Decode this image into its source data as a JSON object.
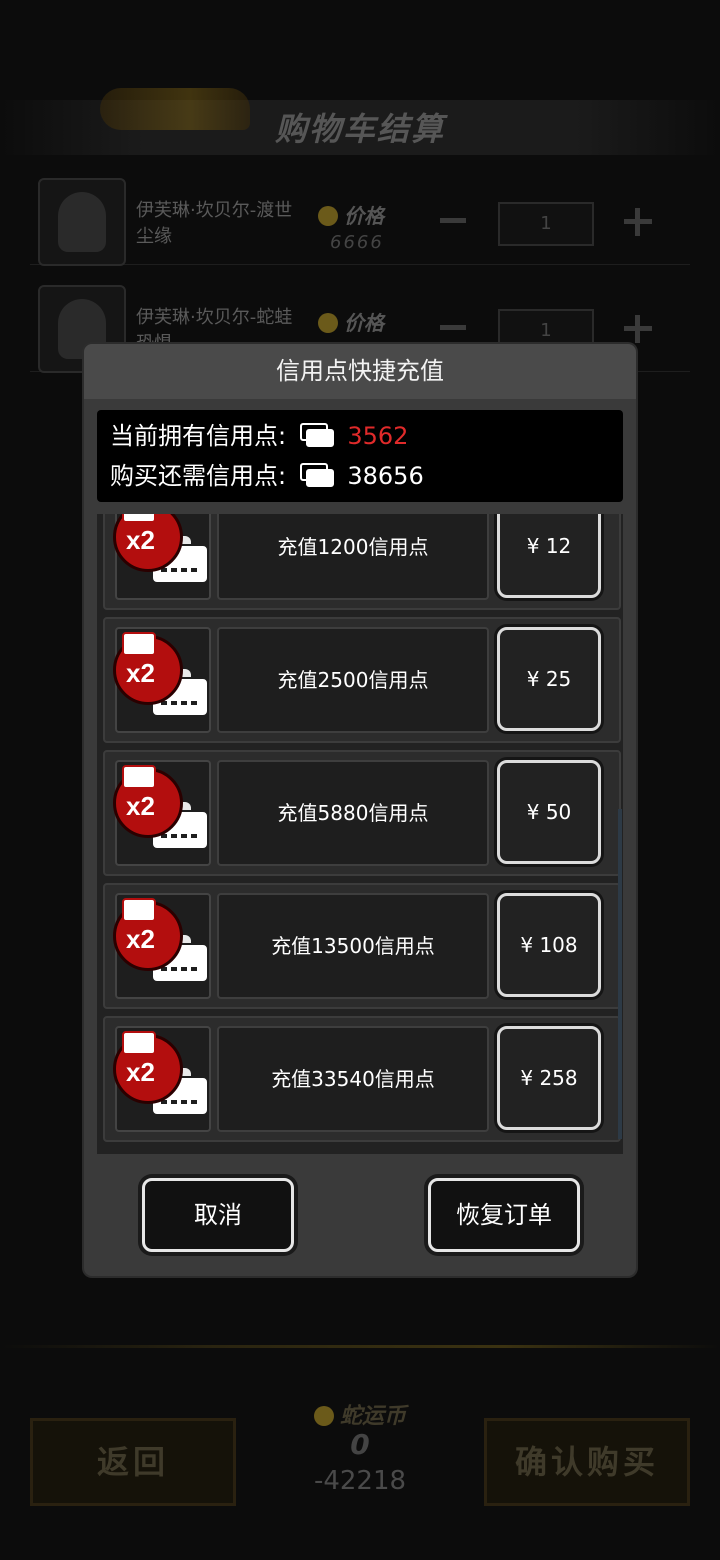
{
  "background": {
    "title": "购物车结算",
    "items": [
      {
        "name": "伊芙琳·坎贝尔-渡世尘缘",
        "price_label": "价格",
        "price": "6666",
        "qty": "1"
      },
      {
        "name": "伊芙琳·坎贝尔-蛇蛙恐惧",
        "price_label": "价格",
        "price": "",
        "qty": "1"
      }
    ],
    "currency_label": "蛇运币",
    "currency_value": "0",
    "difference": "-42218",
    "back_label": "返回",
    "confirm_label": "确认购买"
  },
  "modal": {
    "title": "信用点快捷充值",
    "current_label": "当前拥有信用点:",
    "current_value": "3562",
    "needed_label": "购买还需信用点:",
    "needed_value": "38656",
    "badge": "x2",
    "packs": [
      {
        "label": "充值1200信用点",
        "price": "¥ 12"
      },
      {
        "label": "充值2500信用点",
        "price": "¥ 25"
      },
      {
        "label": "充值5880信用点",
        "price": "¥ 50"
      },
      {
        "label": "充值13500信用点",
        "price": "¥ 108"
      },
      {
        "label": "充值33540信用点",
        "price": "¥ 258"
      }
    ],
    "cancel_label": "取消",
    "restore_label": "恢复订单"
  },
  "colors": {
    "accent_red": "#e02a2a",
    "badge_red": "#b30e0e",
    "modal_bg": "#3a3a3a"
  },
  "icons": [
    "credit-card-icon",
    "coin-icon",
    "plus-icon",
    "minus-icon"
  ]
}
